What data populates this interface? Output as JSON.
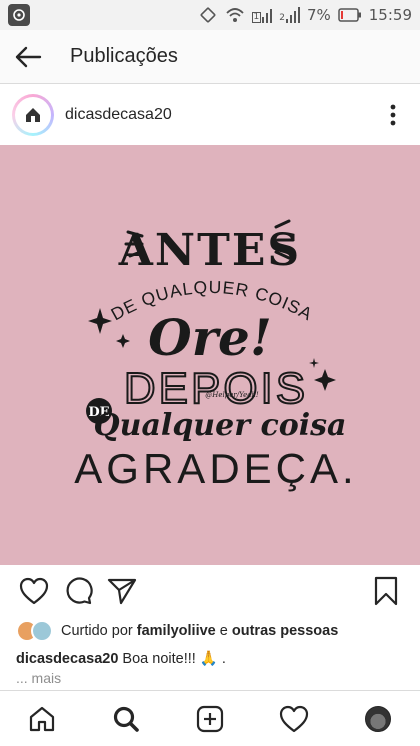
{
  "status_bar": {
    "battery_percent": "7%",
    "time": "15:59",
    "sim_label": "1",
    "network_label": "2"
  },
  "header": {
    "title": "Publicações"
  },
  "post": {
    "username": "dicasdecasa20",
    "image_text": {
      "line1": "ANTES",
      "line2": "DE QUALQUER COISA",
      "line3": "Ore!",
      "line4": "DEPOIS",
      "line5_badge": "DE",
      "line5": "Qualquer coisa",
      "line6": "AGRADEÇA.",
      "signature": "@Helper/Yeah!"
    },
    "image_bg_color": "#dfb3bd"
  },
  "likes": {
    "prefix": "Curtido por",
    "user": "familyoliive",
    "connector": "e",
    "others": "outras pessoas"
  },
  "caption": {
    "username": "dicasdecasa20",
    "text": "Boa noite!!! 🙏 ."
  },
  "more_label": "... mais",
  "icons": {
    "back": "arrow-left-icon",
    "more": "vertical-dots-icon",
    "like": "heart-icon",
    "comment": "comment-bubble-icon",
    "share": "paper-plane-icon",
    "save": "bookmark-icon",
    "home": "home-icon",
    "search": "search-icon",
    "new_post": "plus-square-icon",
    "activity": "heart-icon"
  }
}
